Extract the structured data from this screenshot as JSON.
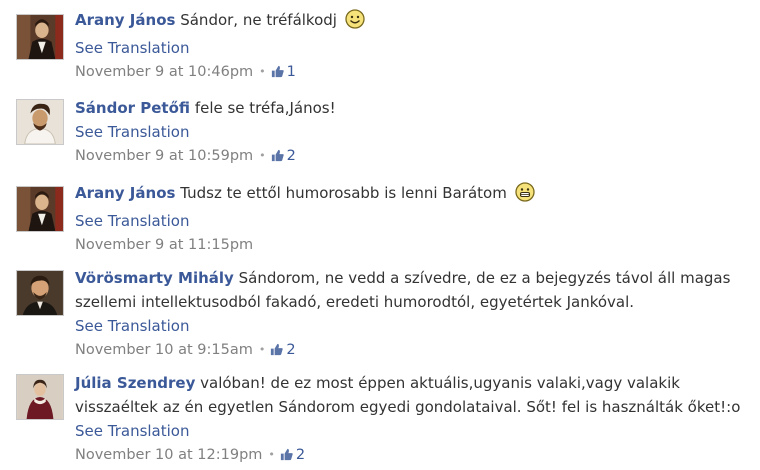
{
  "comments": [
    {
      "author": "Arany János",
      "text": "Sándor, ne tréfálkodj",
      "emoticon": "smiley",
      "translate_label": "See Translation",
      "timestamp": "November 9 at 10:46pm",
      "likes": "1"
    },
    {
      "author": "Sándor Petőfi",
      "text": "fele se tréfa,János!",
      "emoticon": null,
      "translate_label": "See Translation",
      "timestamp": "November 9 at 10:59pm",
      "likes": "2"
    },
    {
      "author": "Arany János",
      "text": "Tudsz te ettől humorosabb is lenni Barátom",
      "emoticon": "grin",
      "translate_label": "See Translation",
      "timestamp": "November 9 at 11:15pm",
      "likes": null
    },
    {
      "author": "Vörösmarty Mihály",
      "text": "Sándorom, ne vedd a szívedre, de ez a bejegyzés távol áll magas szellemi intellektusodból fakadó, eredeti humorodtól, egyetértek Jankóval.",
      "emoticon": null,
      "translate_label": "See Translation",
      "timestamp": "November 10 at 9:15am",
      "likes": "2"
    },
    {
      "author": "Júlia Szendrey",
      "text": "valóban! de ez most éppen aktuális,ugyanis valaki,vagy valakik visszaéltek az én egyetlen Sándorom egyedi gondolataival. Sőt! fel is használták őket!:o",
      "emoticon": null,
      "translate_label": "See Translation",
      "timestamp": "November 10 at 12:19pm",
      "likes": "2"
    }
  ],
  "colors": {
    "link": "#3b5998",
    "timestamp": "#808080",
    "text": "#333333"
  },
  "icons": {
    "emoticon": "smiley-face-icon",
    "like": "thumbs-up-icon",
    "avatar": "portrait-icon"
  }
}
